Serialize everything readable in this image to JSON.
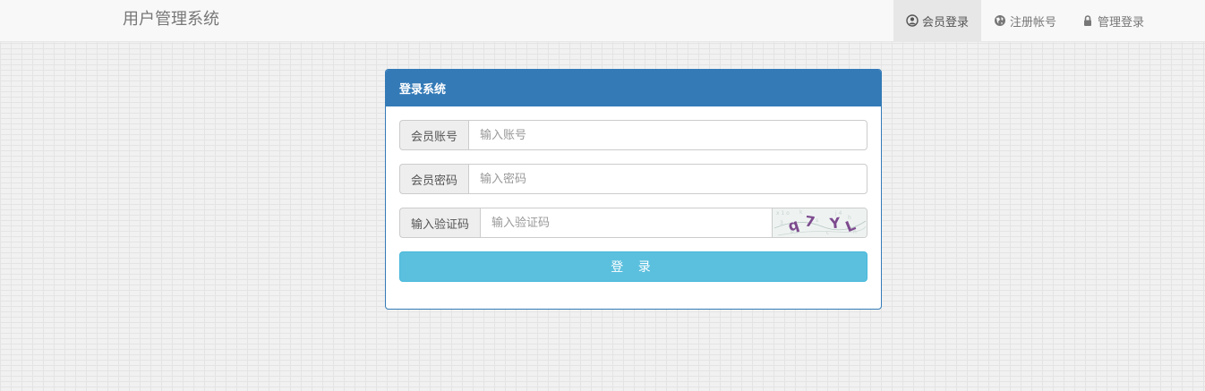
{
  "navbar": {
    "brand": "用户管理系统",
    "items": [
      {
        "label": "会员登录",
        "icon": "user-circle-icon",
        "active": true
      },
      {
        "label": "注册帐号",
        "icon": "globe-icon",
        "active": false
      },
      {
        "label": "管理登录",
        "icon": "lock-icon",
        "active": false
      }
    ]
  },
  "login": {
    "title": "登录系统",
    "account": {
      "label": "会员账号",
      "placeholder": "输入账号"
    },
    "password": {
      "label": "会员密码",
      "placeholder": "输入密码"
    },
    "captcha": {
      "label": "输入验证码",
      "placeholder": "输入验证码",
      "code": "q7YL"
    },
    "submit_label": "登 录"
  },
  "colors": {
    "primary": "#337ab7",
    "info_button": "#5bc0de",
    "navbar_bg": "#f8f8f8"
  }
}
